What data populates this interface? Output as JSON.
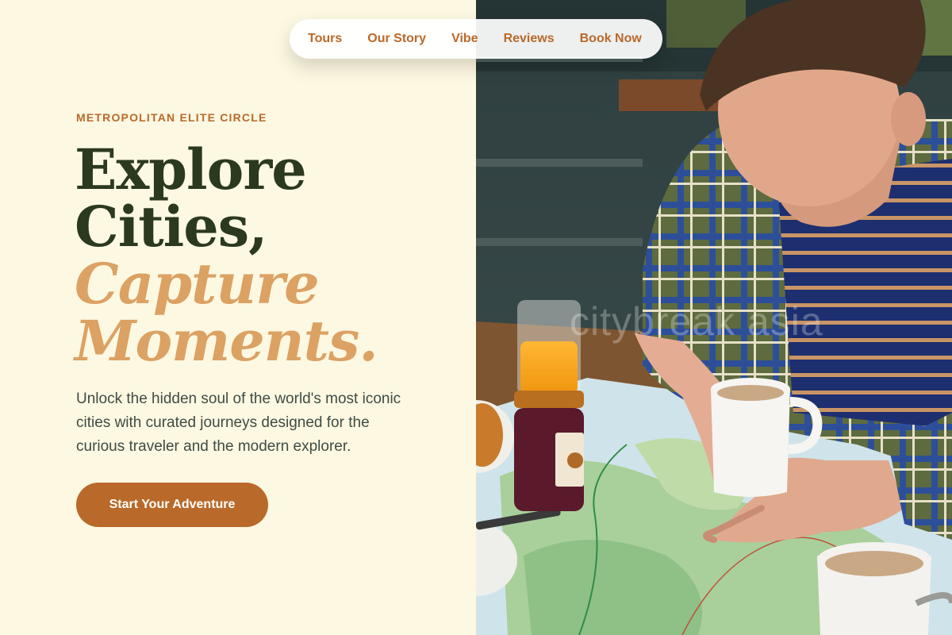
{
  "nav": {
    "items": [
      {
        "label": "Tours"
      },
      {
        "label": "Our Story"
      },
      {
        "label": "Vibe"
      },
      {
        "label": "Reviews"
      },
      {
        "label": "Book Now"
      }
    ]
  },
  "hero": {
    "eyebrow": "METROPOLITAN ELITE CIRCLE",
    "title_line1": "Explore",
    "title_line2": "Cities,",
    "title_line3": "Capture",
    "title_line4": "Moments.",
    "description": "Unlock the hidden soul of the world's most iconic cities with curated journeys designed for the curious traveler and the modern explorer.",
    "cta_label": "Start Your Adventure"
  },
  "photo": {
    "watermark": "citybreak asia"
  },
  "colors": {
    "background": "#fdf8e1",
    "accent": "#b9692a",
    "headline_dark": "#2b3a1f",
    "headline_accent": "#dca264"
  }
}
